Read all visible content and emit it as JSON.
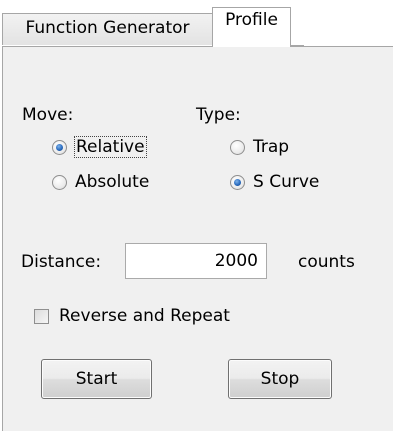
{
  "tabs": {
    "function_generator": "Function Generator",
    "profile": "Profile"
  },
  "move": {
    "label": "Move:",
    "options": [
      {
        "label": "Relative",
        "selected": true
      },
      {
        "label": "Absolute",
        "selected": false
      }
    ]
  },
  "type": {
    "label": "Type:",
    "options": [
      {
        "label": "Trap",
        "selected": false
      },
      {
        "label": "S Curve",
        "selected": true
      }
    ]
  },
  "distance": {
    "label": "Distance:",
    "value": "2000",
    "unit": "counts"
  },
  "reverse_repeat": {
    "label": "Reverse and Repeat",
    "checked": false
  },
  "buttons": {
    "start": "Start",
    "stop": "Stop"
  },
  "colors": {
    "panel_background": "#f0f0f0",
    "tab_border": "#a6a6a6",
    "radio_selected": "#2a6cc0"
  }
}
